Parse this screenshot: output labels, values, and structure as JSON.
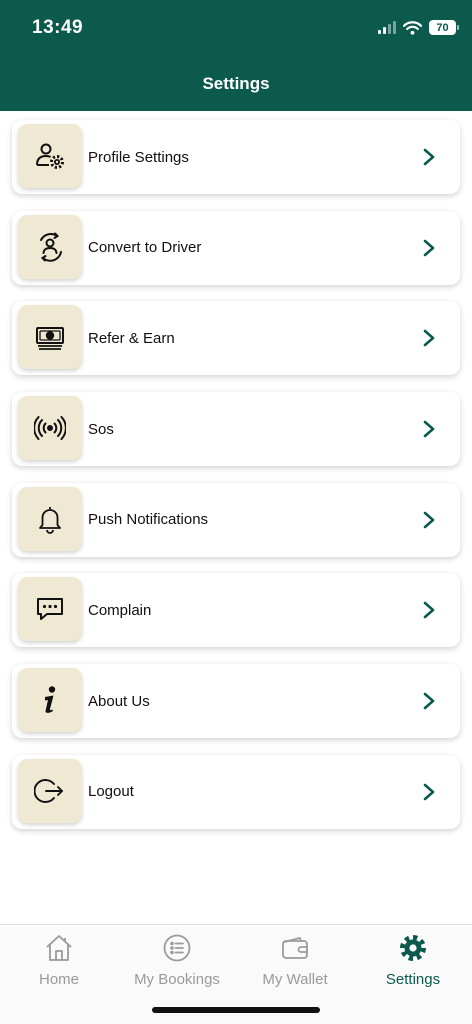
{
  "status_bar": {
    "time": "13:49",
    "battery": "70"
  },
  "header": {
    "title": "Settings"
  },
  "settings": [
    {
      "label": "Profile Settings",
      "icon": "user-gear-icon"
    },
    {
      "label": "Convert to Driver",
      "icon": "convert-driver-icon"
    },
    {
      "label": "Refer & Earn",
      "icon": "money-icon"
    },
    {
      "label": "Sos",
      "icon": "broadcast-icon"
    },
    {
      "label": "Push Notifications",
      "icon": "bell-icon"
    },
    {
      "label": "Complain",
      "icon": "chat-icon"
    },
    {
      "label": "About Us",
      "icon": "info-icon"
    },
    {
      "label": "Logout",
      "icon": "logout-icon"
    }
  ],
  "tabs": [
    {
      "label": "Home",
      "icon": "home-icon"
    },
    {
      "label": "My Bookings",
      "icon": "list-icon"
    },
    {
      "label": "My Wallet",
      "icon": "wallet-icon"
    },
    {
      "label": "Settings",
      "icon": "gear-icon"
    }
  ],
  "colors": {
    "brand": "#0c5a4b",
    "icon_tile": "#efe8d3",
    "inactive_tab": "#9a9a9a"
  }
}
